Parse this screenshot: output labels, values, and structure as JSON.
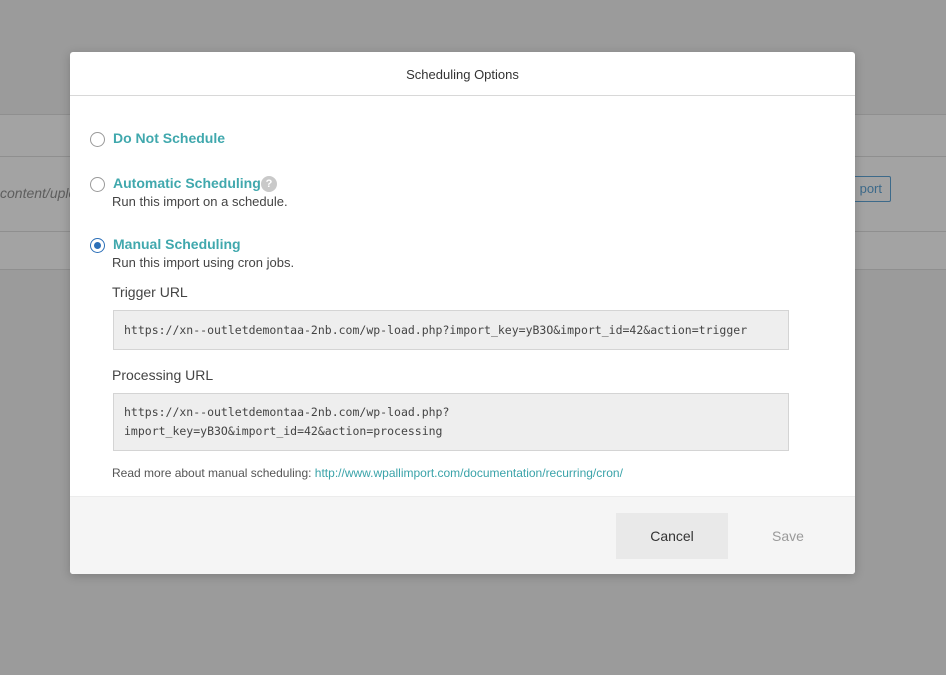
{
  "background": {
    "path_fragment": "content/uploa",
    "button_fragment": "port"
  },
  "modal": {
    "title": "Scheduling Options",
    "options": [
      {
        "label": "Do Not Schedule",
        "selected": false
      },
      {
        "label": "Automatic Scheduling",
        "description": "Run this import on a schedule.",
        "selected": false,
        "help_icon": "?"
      },
      {
        "label": "Manual Scheduling",
        "description": "Run this import using cron jobs.",
        "selected": true
      }
    ],
    "trigger": {
      "label": "Trigger URL",
      "url": "https://xn--outletdemontaa-2nb.com/wp-load.php?import_key=yB3O&import_id=42&action=trigger"
    },
    "processing": {
      "label": "Processing URL",
      "url_line1": "https://xn--outletdemontaa-2nb.com/wp-load.php?",
      "url_line2": "import_key=yB3O&import_id=42&action=processing"
    },
    "read_more": {
      "text": "Read more about manual scheduling: ",
      "link": "http://www.wpallimport.com/documentation/recurring/cron/"
    },
    "footer": {
      "cancel_label": "Cancel",
      "save_label": "Save"
    }
  },
  "colors": {
    "accent_teal": "#40a8ad",
    "radio_blue": "#2b6fb8",
    "overlay": "#9b9b9b"
  }
}
